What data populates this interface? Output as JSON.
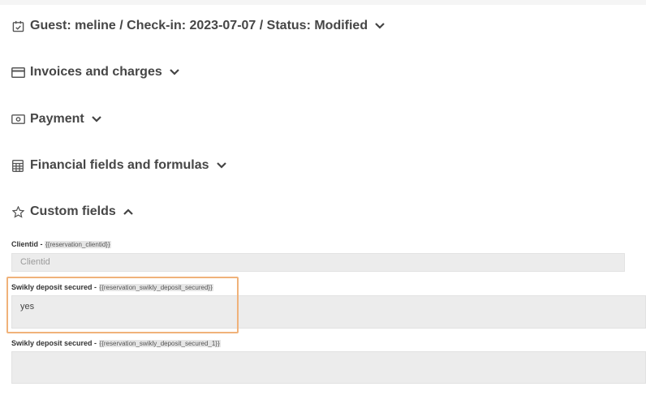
{
  "sections": {
    "guest": {
      "title": "Guest: meline / Check-in: 2023-07-07 / Status: Modified",
      "icon": "calendar-check-icon",
      "state": "collapsed"
    },
    "invoices": {
      "title": "Invoices and charges",
      "icon": "credit-card-icon",
      "state": "collapsed"
    },
    "payment": {
      "title": "Payment",
      "icon": "banknote-icon",
      "state": "collapsed"
    },
    "financial": {
      "title": "Financial fields and formulas",
      "icon": "calculator-icon",
      "state": "collapsed"
    },
    "custom": {
      "title": "Custom fields",
      "icon": "star-icon",
      "state": "expanded"
    }
  },
  "custom_fields": {
    "clientid": {
      "label": "Clientid - ",
      "tag": "{{reservation_clientid}}",
      "placeholder": "Clientid",
      "value": ""
    },
    "swikly": {
      "label": "Swikly deposit secured - ",
      "tag": "{{reservation_swikly_deposit_secured}}",
      "value": "yes"
    },
    "swikly_1": {
      "label": "Swikly deposit secured - ",
      "tag": "{{reservation_swikly_deposit_secured_1}}",
      "value": ""
    }
  },
  "colors": {
    "highlight": "#f0b27a",
    "input_bg": "#ececec",
    "heading": "#464646"
  }
}
